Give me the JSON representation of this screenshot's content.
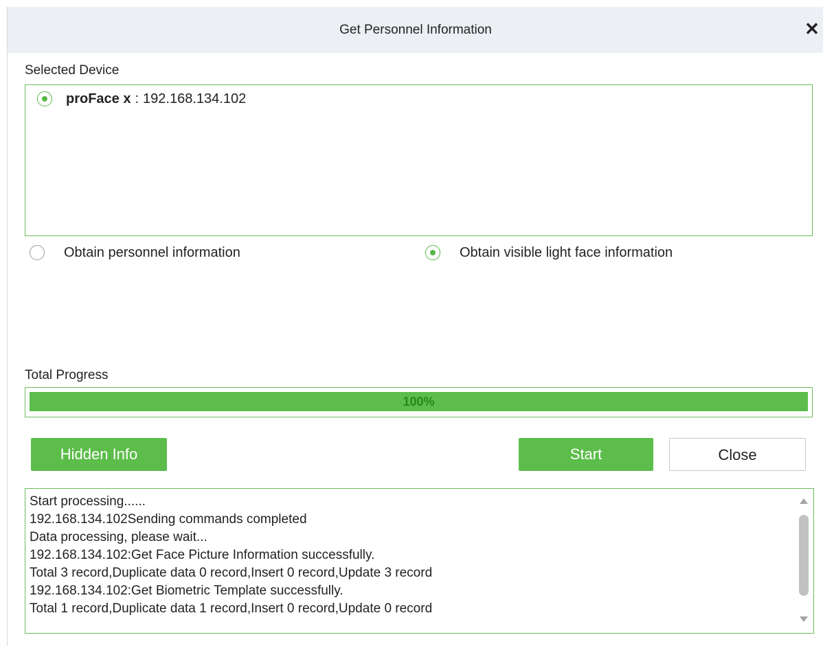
{
  "dialog": {
    "title": "Get Personnel Information",
    "close_icon": "close-icon"
  },
  "selected_device": {
    "label": "Selected Device",
    "devices": [
      {
        "name": "proFace x",
        "separator": ":",
        "ip": "192.168.134.102",
        "selected": true
      }
    ]
  },
  "options": [
    {
      "label": "Obtain personnel information",
      "selected": false
    },
    {
      "label": "Obtain visible light face information",
      "selected": true
    }
  ],
  "progress": {
    "label": "Total Progress",
    "value_text": "100%",
    "fraction": 1.0
  },
  "buttons": {
    "hidden_info": "Hidden Info",
    "start": "Start",
    "close": "Close"
  },
  "log": {
    "lines": [
      "Start processing......",
      "192.168.134.102Sending commands completed",
      "Data processing, please wait...",
      "192.168.134.102:Get Face Picture Information successfully.",
      "Total 3 record,Duplicate data 0 record,Insert 0 record,Update 3 record",
      "192.168.134.102:Get Biometric Template successfully.",
      "Total 1 record,Duplicate data 1 record,Insert 0 record,Update 0 record"
    ]
  },
  "colors": {
    "accent": "#5cbd4a",
    "border": "#6dbb5c",
    "title_bar": "#eceff3",
    "progress_text": "#238a1c"
  }
}
